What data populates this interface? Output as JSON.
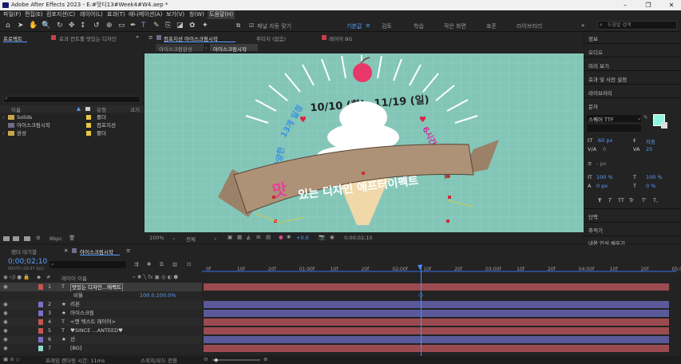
{
  "window": {
    "title": "Adobe After Effects 2023 - E:#맛디13#Week4#W4.aep *",
    "min": "–",
    "max": "❐",
    "close": "✕"
  },
  "menu": [
    "파일(F)",
    "편집(E)",
    "컴포지션(C)",
    "레이어(L)",
    "효과(T)",
    "애니메이션(A)",
    "보기(V)",
    "창(W)",
    "도움말(H)"
  ],
  "toolbar": {
    "snap_label": "패널 자동 맞기",
    "workspaces": [
      "기본값",
      "검토",
      "학습",
      "작은 화면",
      "표준",
      "라이브러리"
    ],
    "search_placeholder": "도움말 검색"
  },
  "project_panel": {
    "tab_project": "프로젝트",
    "tab_effects": "효과 컨트롤 맛있는 디자인",
    "search_placeholder": "",
    "col_name": "이름",
    "col_type": "유형",
    "col_size": "크기",
    "bpc": "8bpc",
    "items": [
      {
        "name": "Solids",
        "type": "폴더",
        "color": "#e8c840"
      },
      {
        "name": "아이스크림시작",
        "type": "컴포지션",
        "color": "#e8c840"
      },
      {
        "name": "완성",
        "type": "폴더",
        "color": "#e8c840"
      }
    ]
  },
  "viewer": {
    "tab_comp": "컴포지션 아이스크림시작",
    "tab_footage": "푸티지 (없음)",
    "tab_layer": "레이어 BG",
    "crumb1": "아이스크림완성",
    "crumb2": "아이스크림시작",
    "zoom": "100%",
    "resolution": "전체",
    "exposure": "+0.0",
    "timecode": "0;00;02;10",
    "art": {
      "date": "10/10 (화)~11/19 (일)",
      "left_curve1": "13개 일정",
      "left_curve2": "다양한",
      "right_curve1": "6시간",
      "right_curve2": "월별 무료",
      "ribbon_big": "맛",
      "ribbon_text": "있는 디자인 애프터이펙트"
    }
  },
  "right_panel": {
    "items": [
      "정보",
      "오디오",
      "미리 보기",
      "효과 및 사전 설정",
      "라이브러리",
      "문자"
    ],
    "font": "스퀘어 TTF",
    "size": "60 px",
    "leading": "자동",
    "kerning": "0",
    "tracking": "25",
    "stroke": "- px",
    "scale_v": "100 %",
    "scale_h": "100 %",
    "baseline": "0 px",
    "tsume": "0 %",
    "style_buttons": [
      "T",
      "T",
      "TT",
      "Tr",
      "T'",
      "T,"
    ],
    "paragraph": "단락",
    "tracker": "추적기",
    "content_aware": "내용 인식 채우기",
    "swatch_color": "#8ff5e0"
  },
  "timeline": {
    "tab_render": "렌더 대기열",
    "tab_comp": "아이스크림시작",
    "timecode": "0;00;02;10",
    "fps": "00070 (29.97 fps)",
    "col_layer": "레이어 이름",
    "ticks": [
      "0f",
      "10f",
      "20f",
      "01:00f",
      "10f",
      "20f",
      "02:00f",
      "10f",
      "20f",
      "03:00f",
      "10f",
      "20f",
      "04:00f",
      "10f",
      "20f",
      "05:0"
    ],
    "layers": [
      {
        "num": "1",
        "icon": "T",
        "name": "맛있는 디자인...애펙트",
        "label": "#c8554f",
        "bar": "#9b4a50"
      },
      {
        "num": "",
        "icon": "",
        "name": "비율",
        "label": "",
        "bar": "",
        "value": "100.0,100.0%"
      },
      {
        "num": "2",
        "icon": "★",
        "name": "리본",
        "label": "#7a70c8",
        "bar": "#5a5a9a"
      },
      {
        "num": "3",
        "icon": "★",
        "name": "아이스크림",
        "label": "#7a70c8",
        "bar": "#5a5a9a"
      },
      {
        "num": "4",
        "icon": "T",
        "name": "<맨 텍스트 레이어>",
        "label": "#c8554f",
        "bar": "#9b4a50"
      },
      {
        "num": "5",
        "icon": "T",
        "name": "♥SINCE ...ANTEED♥",
        "label": "#c8554f",
        "bar": "#9b4a50"
      },
      {
        "num": "6",
        "icon": "★",
        "name": "선",
        "label": "#7a70c8",
        "bar": "#5a5a9a"
      },
      {
        "num": "7",
        "icon": "",
        "name": "[BG]",
        "label": "#8fd8c8",
        "bar": "#9b4a50"
      }
    ],
    "footer_left": "프레임 렌더링 시간: 11ms",
    "footer_mid": "스위치/모드 전환"
  }
}
